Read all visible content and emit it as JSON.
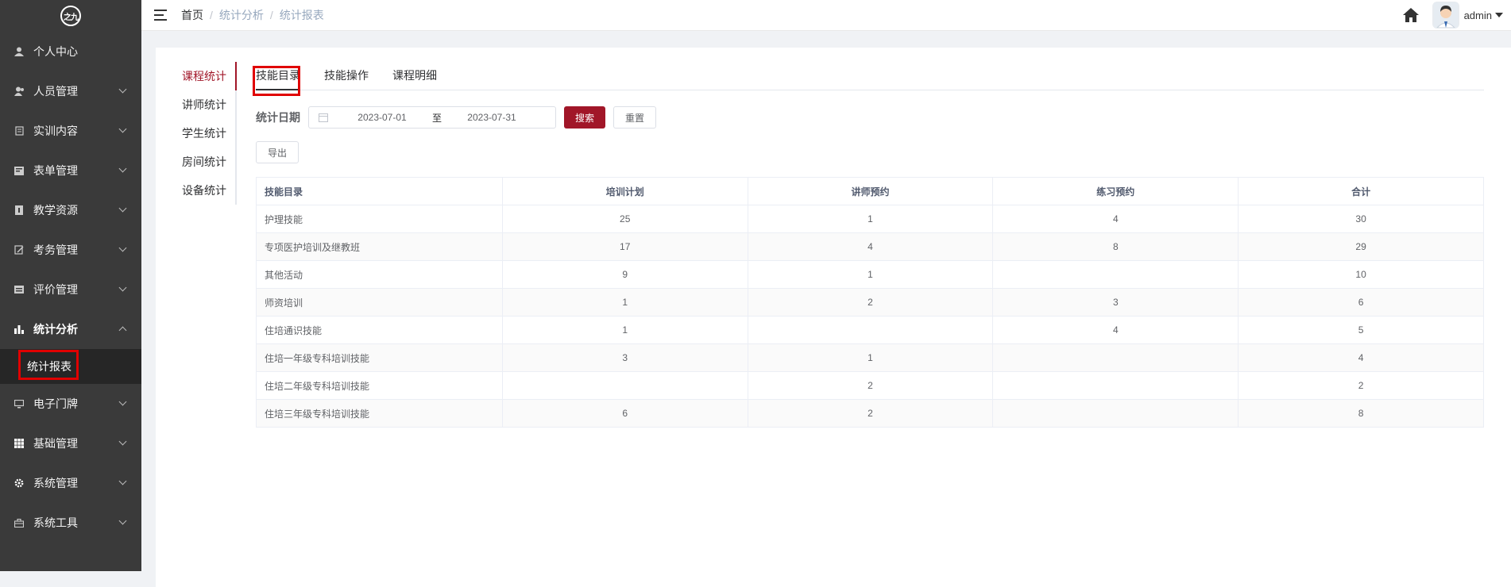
{
  "logo": {
    "text": "之九"
  },
  "sidebar": {
    "items": [
      {
        "label": "个人中心",
        "icon": "user-icon",
        "has_children": false
      },
      {
        "label": "人员管理",
        "icon": "users-icon",
        "has_children": true
      },
      {
        "label": "实训内容",
        "icon": "book-icon",
        "has_children": true
      },
      {
        "label": "表单管理",
        "icon": "form-icon",
        "has_children": true
      },
      {
        "label": "教学资源",
        "icon": "resource-icon",
        "has_children": true
      },
      {
        "label": "考务管理",
        "icon": "exam-icon",
        "has_children": true
      },
      {
        "label": "评价管理",
        "icon": "rating-icon",
        "has_children": true
      },
      {
        "label": "统计分析",
        "icon": "bar-chart-icon",
        "has_children": true,
        "expanded": true
      },
      {
        "label": "电子门牌",
        "icon": "monitor-icon",
        "has_children": true
      },
      {
        "label": "基础管理",
        "icon": "grid-icon",
        "has_children": true
      },
      {
        "label": "系统管理",
        "icon": "gear-icon",
        "has_children": true
      },
      {
        "label": "系统工具",
        "icon": "toolbox-icon",
        "has_children": true
      }
    ],
    "submenu": {
      "label": "统计报表"
    }
  },
  "header": {
    "breadcrumb": [
      "首页",
      "统计分析",
      "统计报表"
    ],
    "username": "admin"
  },
  "left_tabs": [
    "课程统计",
    "讲师统计",
    "学生统计",
    "房间统计",
    "设备统计"
  ],
  "top_tabs": [
    "技能目录",
    "技能操作",
    "课程明细"
  ],
  "filter": {
    "label": "统计日期",
    "start_date": "2023-07-01",
    "range_separator": "至",
    "end_date": "2023-07-31",
    "search_label": "搜索",
    "reset_label": "重置",
    "export_label": "导出"
  },
  "table": {
    "columns": [
      "技能目录",
      "培训计划",
      "讲师预约",
      "练习预约",
      "合计"
    ],
    "rows": [
      [
        "护理技能",
        "25",
        "1",
        "4",
        "30"
      ],
      [
        "专项医护培训及继教班",
        "17",
        "4",
        "8",
        "29"
      ],
      [
        "其他活动",
        "9",
        "1",
        "",
        "10"
      ],
      [
        "师资培训",
        "1",
        "2",
        "3",
        "6"
      ],
      [
        "住培通识技能",
        "1",
        "",
        "4",
        "5"
      ],
      [
        "住培一年级专科培训技能",
        "3",
        "1",
        "",
        "4"
      ],
      [
        "住培二年级专科培训技能",
        "",
        "2",
        "",
        "2"
      ],
      [
        "住培三年级专科培训技能",
        "6",
        "2",
        "",
        "8"
      ]
    ]
  },
  "colors": {
    "accent": "#a11628",
    "sidebar_bg": "#3a3a3a",
    "highlight_box": "#e00000"
  }
}
